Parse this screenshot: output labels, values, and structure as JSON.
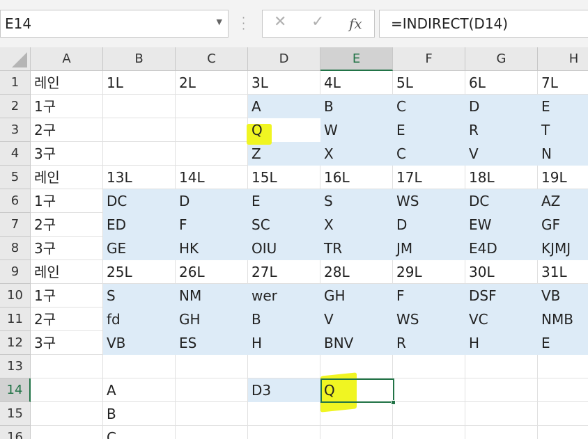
{
  "formula_bar": {
    "name_box": "E14",
    "cancel_icon": "✕",
    "enter_icon": "✓",
    "fx_label": "fx",
    "formula": "=INDIRECT(D14)"
  },
  "columns": [
    "A",
    "B",
    "C",
    "D",
    "E",
    "F",
    "G",
    "H"
  ],
  "rows": [
    "1",
    "2",
    "3",
    "4",
    "5",
    "6",
    "7",
    "8",
    "9",
    "10",
    "11",
    "12",
    "13",
    "14",
    "15",
    "16"
  ],
  "selected": {
    "column": "E",
    "row": "14"
  },
  "highlight_color": "#f0f522",
  "fill_color": "#ddebf7",
  "accent_color": "#217346",
  "cells": [
    [
      "레인",
      "1L",
      "2L",
      "3L",
      "4L",
      "5L",
      "6L",
      "7L"
    ],
    [
      "1구",
      "",
      "",
      "A",
      "B",
      "C",
      "D",
      "E"
    ],
    [
      "2구",
      "",
      "",
      "Q",
      "W",
      "E",
      "R",
      "T"
    ],
    [
      "3구",
      "",
      "",
      "Z",
      "X",
      "C",
      "V",
      "N"
    ],
    [
      "레인",
      "13L",
      "14L",
      "15L",
      "16L",
      "17L",
      "18L",
      "19L"
    ],
    [
      "1구",
      "DC",
      "D",
      "E",
      "S",
      "WS",
      "DC",
      "AZ"
    ],
    [
      "2구",
      "ED",
      "F",
      "SC",
      "X",
      "D",
      "EW",
      "GF"
    ],
    [
      "3구",
      "GE",
      "HK",
      "OIU",
      "TR",
      "JM",
      "E4D",
      "KJMJ"
    ],
    [
      "레인",
      "25L",
      "26L",
      "27L",
      "28L",
      "29L",
      "30L",
      "31L"
    ],
    [
      "1구",
      "S",
      "NM",
      "wer",
      "GH",
      "F",
      "DSF",
      "VB"
    ],
    [
      "2구",
      "fd",
      "GH",
      "B",
      "V",
      "WS",
      "VC",
      "NMB"
    ],
    [
      "3구",
      "VB",
      "ES",
      "H",
      "BNV",
      "R",
      "H",
      "E"
    ],
    [
      "",
      "",
      "",
      "",
      "",
      "",
      "",
      ""
    ],
    [
      "",
      "A",
      "",
      "D3",
      "Q",
      "",
      "",
      ""
    ],
    [
      "",
      "B",
      "",
      "",
      "",
      "",
      "",
      ""
    ],
    [
      "",
      "C",
      "",
      "",
      "",
      "",
      "",
      ""
    ]
  ]
}
